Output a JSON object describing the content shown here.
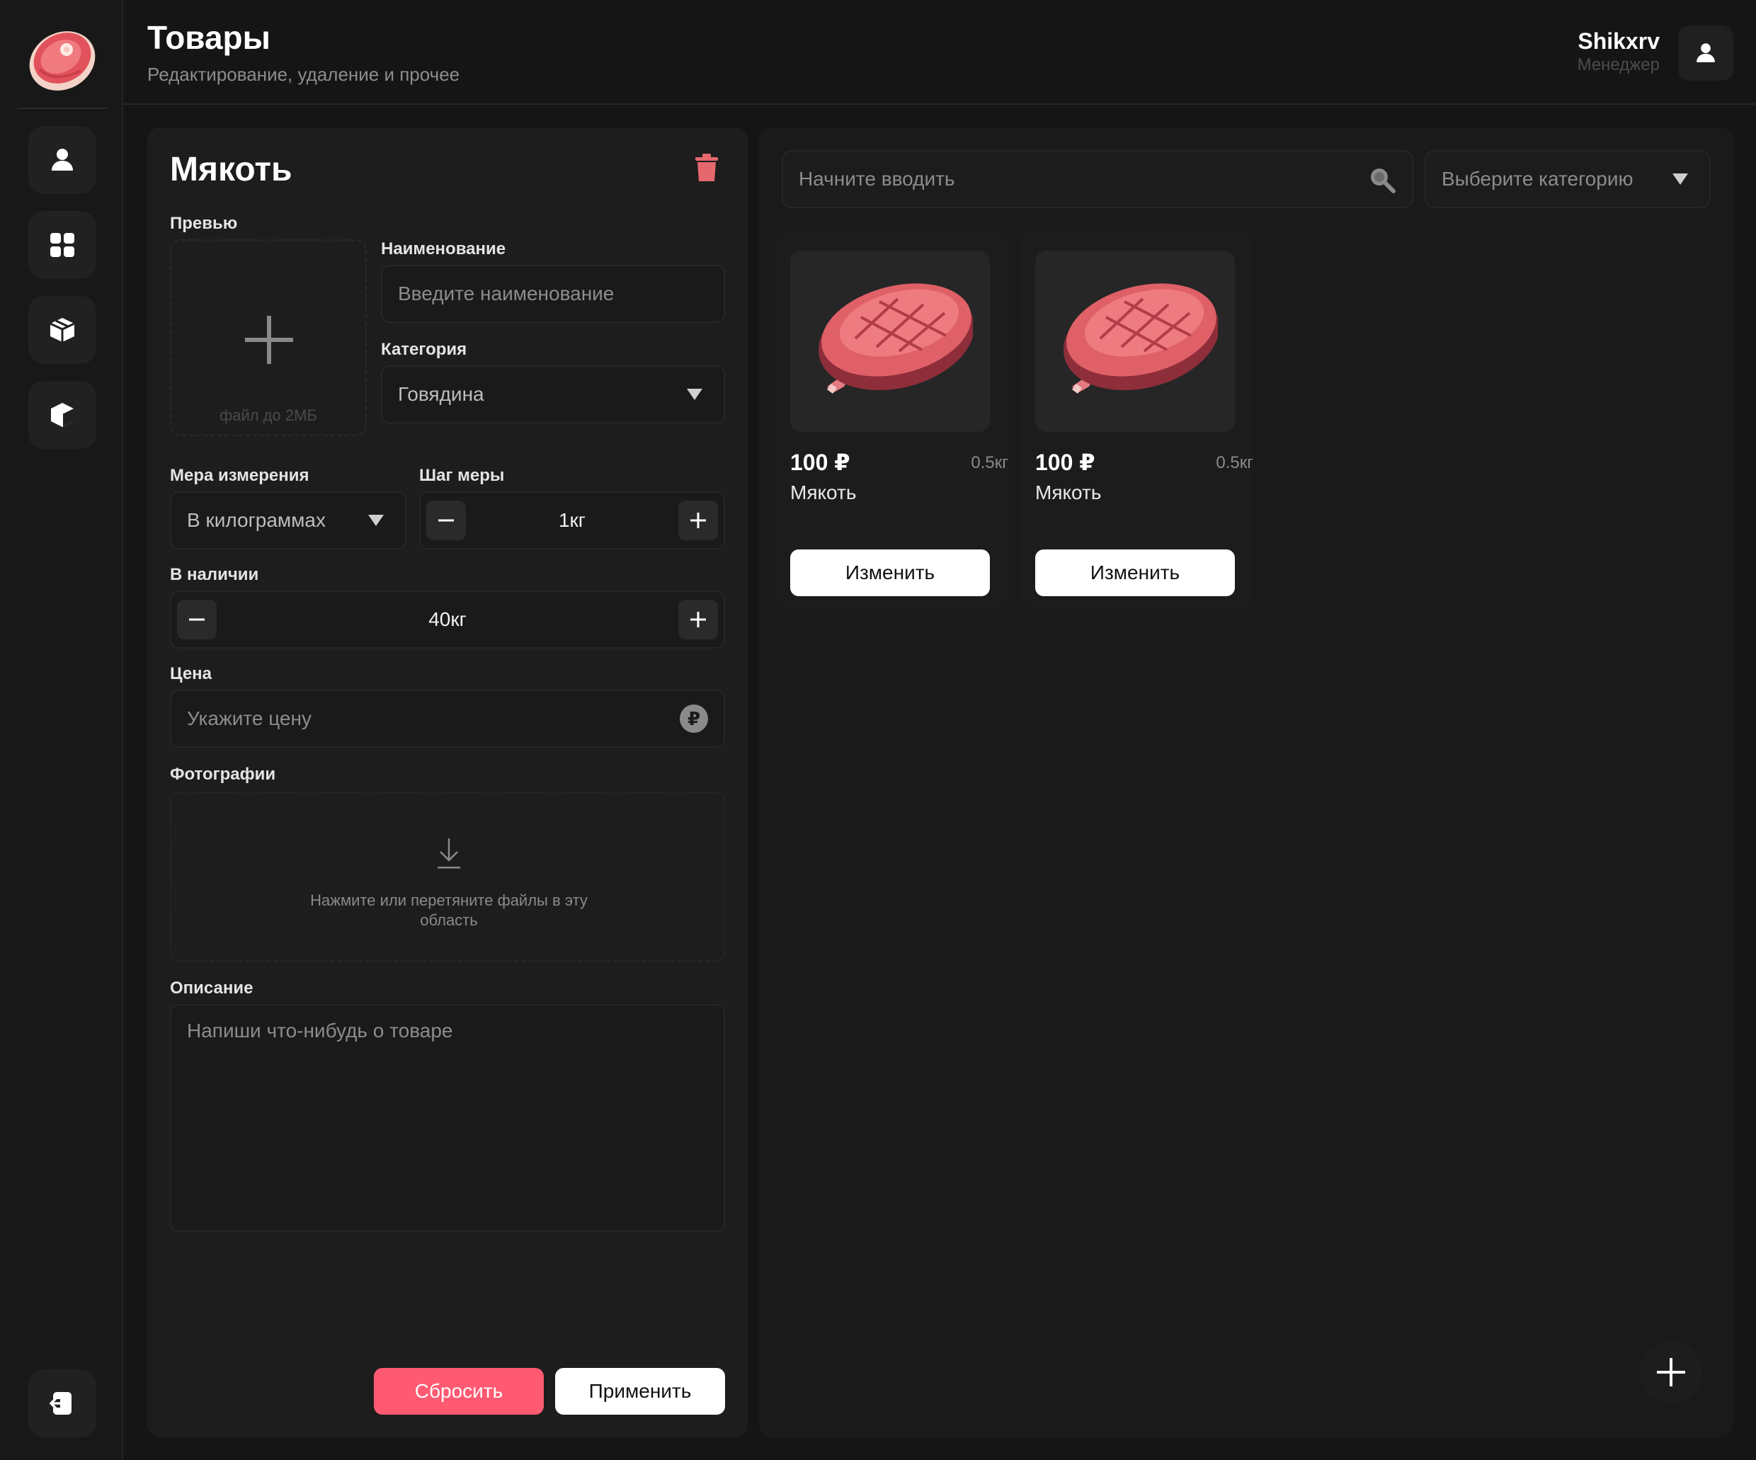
{
  "header": {
    "title": "Товары",
    "subtitle": "Редактирование, удаление и прочее",
    "user_name": "Shikxrv",
    "user_role": "Менеджер"
  },
  "sidebar": {
    "items": [
      {
        "icon": "user-icon"
      },
      {
        "icon": "grid-icon"
      },
      {
        "icon": "boxes-icon"
      },
      {
        "icon": "cube-icon"
      }
    ],
    "bottom": {
      "icon": "logout-icon"
    }
  },
  "editor": {
    "title": "Мякоть",
    "preview_label": "Превью",
    "preview_hint": "файл до 2МБ",
    "name_label": "Наименование",
    "name_placeholder": "Введите наименование",
    "category_label": "Категория",
    "category_value": "Говядина",
    "measure_label": "Мера измерения",
    "measure_value": "В килограммах",
    "step_label": "Шаг меры",
    "step_value": "1кг",
    "stock_label": "В наличии",
    "stock_value": "40кг",
    "price_label": "Цена",
    "price_placeholder": "Укажите цену",
    "currency_symbol": "₽",
    "photos_label": "Фотографии",
    "photos_hint": "Нажмите или перетяните файлы в эту область",
    "description_label": "Описание",
    "description_placeholder": "Напиши что-нибудь о товаре",
    "reset_label": "Сбросить",
    "apply_label": "Применить"
  },
  "catalog": {
    "search_placeholder": "Начните вводить",
    "category_placeholder": "Выберите категорию",
    "products": [
      {
        "price": "100 ₽",
        "weight": "0.5кг",
        "name": "Мякоть",
        "button": "Изменить"
      },
      {
        "price": "100 ₽",
        "weight": "0.5кг",
        "name": "Мякоть",
        "button": "Изменить"
      }
    ]
  },
  "colors": {
    "background": "#151515",
    "panel": "#1d1d1d",
    "accent": "#ff5a72",
    "button_light": "#ffffff",
    "meat": "#e0646a"
  }
}
